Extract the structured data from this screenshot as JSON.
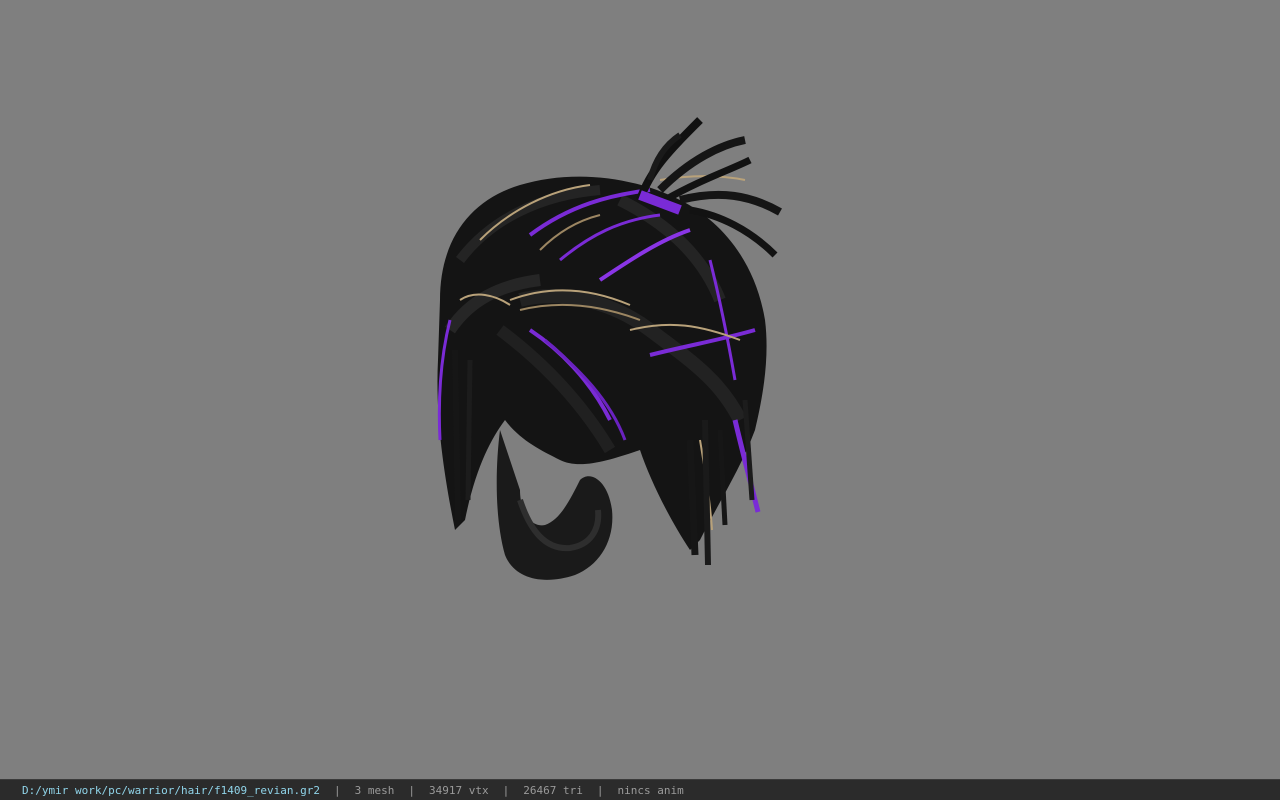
{
  "status_bar": {
    "file_path": "D:/ymir work/pc/warrior/hair/f1409_revian.gr2",
    "separator": "|",
    "mesh_count": "3 mesh",
    "vertex_count": "34917 vtx",
    "triangle_count": "26467 tri",
    "animation": "nincs anim"
  },
  "colors": {
    "background": "#7f7f7f",
    "hair_base": "#141414",
    "hair_purple": "#7a2bd6",
    "hair_gold": "#b9a27a",
    "status_path": "#8fd3e8",
    "status_text": "#9a9a9a"
  }
}
